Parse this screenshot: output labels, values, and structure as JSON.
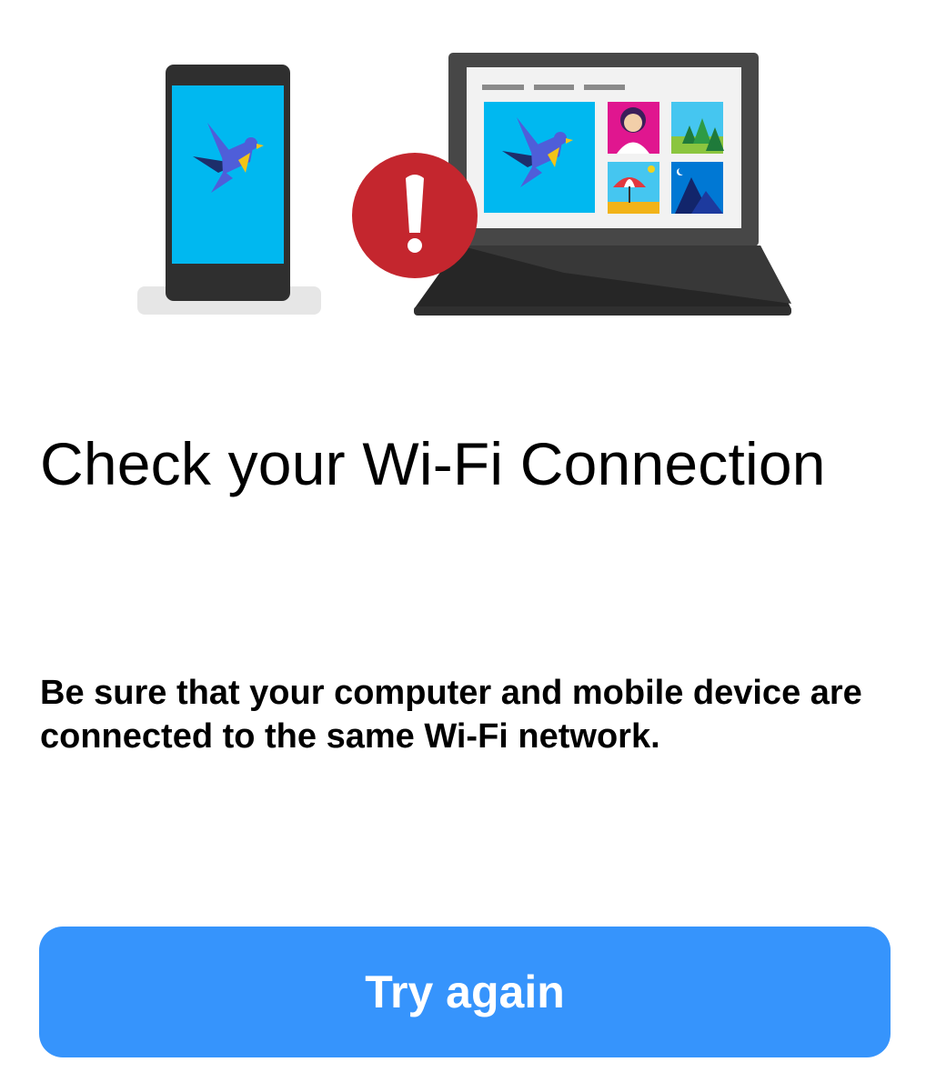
{
  "dialog": {
    "title": "Check your Wi-Fi Connection",
    "message": "Be sure that your computer and mobile device are connected to the same Wi-Fi network.",
    "primary_button_label": "Try again"
  },
  "colors": {
    "accent": "#3694FC",
    "error": "#C4262E",
    "screen_blue": "#00B8F0",
    "device_dark": "#2E2E2E"
  },
  "illustration": {
    "devices": [
      "phone-icon",
      "laptop-icon"
    ],
    "status": "error-alert-icon",
    "photos": [
      "bird-image",
      "person-portrait-image",
      "forest-image",
      "beach-umbrella-image",
      "mountain-night-image"
    ]
  }
}
